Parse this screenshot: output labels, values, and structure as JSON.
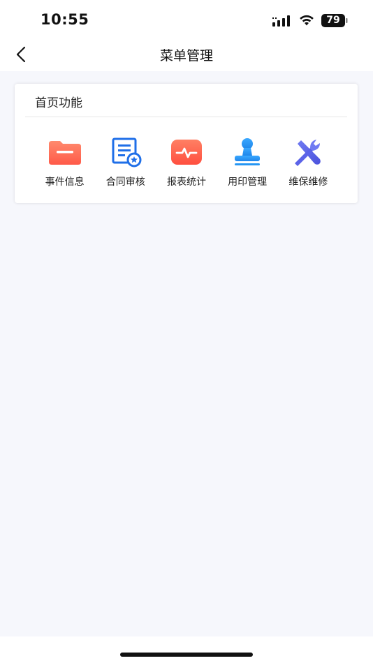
{
  "status_bar": {
    "time": "10:55",
    "battery_level": "79"
  },
  "nav": {
    "title": "菜单管理",
    "back_icon": "chevron-left-icon"
  },
  "section": {
    "title": "首页功能",
    "items": [
      {
        "label": "事件信息",
        "icon": "folder-icon",
        "color": "#ff6a55"
      },
      {
        "label": "合同审核",
        "icon": "contract-review-icon",
        "color": "#1f6fe8"
      },
      {
        "label": "报表统计",
        "icon": "pulse-chart-icon",
        "color": "#ff5a48"
      },
      {
        "label": "用印管理",
        "icon": "stamp-icon",
        "color": "#2596f3"
      },
      {
        "label": "维保维修",
        "icon": "wrench-screwdriver-icon",
        "color": "#5b63e8"
      }
    ]
  },
  "colors": {
    "page_background": "#f6f7fc",
    "card_background": "#ffffff",
    "text": "#222222"
  }
}
